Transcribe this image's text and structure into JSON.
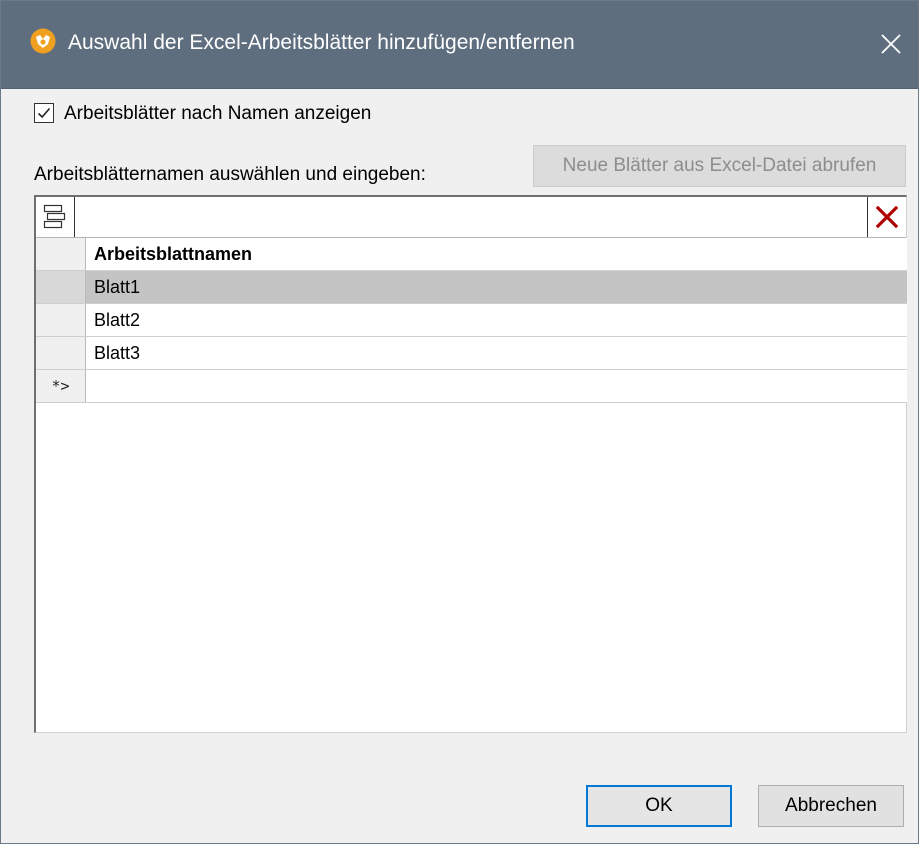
{
  "window": {
    "title": "Auswahl der Excel-Arbeitsblätter hinzufügen/entfernen",
    "titlebar_color": "#5f6e7f"
  },
  "options": {
    "show_by_name_label": "Arbeitsblätter nach Namen anzeigen",
    "show_by_name_checked": true
  },
  "section": {
    "label": "Arbeitsblätternamen auswählen und eingeben:",
    "fetch_button_label": "Neue Blätter aus Excel-Datei abrufen",
    "fetch_button_enabled": false
  },
  "toolbar": {
    "left_icon": "insert-row-icon",
    "right_icon": "delete-icon",
    "delete_icon_color": "#b00000"
  },
  "table": {
    "column_header": "Arbeitsblattnamen",
    "rows": [
      {
        "name": "Blatt1",
        "selected": true
      },
      {
        "name": "Blatt2",
        "selected": false
      },
      {
        "name": "Blatt3",
        "selected": false
      }
    ],
    "new_row_marker": "*>"
  },
  "buttons": {
    "ok_label": "OK",
    "cancel_label": "Abbrechen",
    "default_border_color": "#0078d7"
  }
}
